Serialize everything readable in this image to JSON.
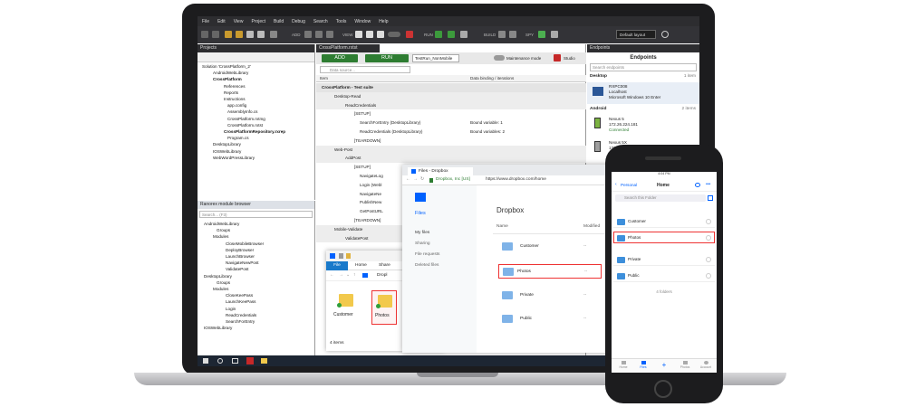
{
  "ide": {
    "menu": [
      "File",
      "Edit",
      "View",
      "Project",
      "Build",
      "Debug",
      "Search",
      "Tools",
      "Window",
      "Help"
    ],
    "toolbar": {
      "add": "ADD",
      "view": "VIEW",
      "run": "RUN",
      "build": "BUILD",
      "spy": "SPY",
      "layout": "Default layout"
    },
    "projects_title": "Projects",
    "projects_tree": [
      "Solution 'CrossPlatform_2'",
      "AndroidWebLibrary",
      "CrossPlatform",
      "References",
      "Reports",
      "Instructions",
      "app.config",
      "AssemblyInfo.cs",
      "CrossPlatform.rxtmg",
      "CrossPlatform.rxtst",
      "CrossPlatformRepository.rxrep",
      "Program.cs",
      "DesktopLibrary",
      "IOSWebLibrary",
      "WebWordPressLibrary"
    ],
    "modules_title": "Ranorex module browser",
    "search_placeholder": "Search... (F3)",
    "modules_tree": [
      "AndroidWebLibrary",
      "Groups",
      "Modules",
      "CloseMobileBrowser",
      "DeployBrowser",
      "LaunchBrowser",
      "NavigateNewPost",
      "ValidatePost",
      "DesktopLibrary",
      "Groups",
      "Modules",
      "CloseKeePass",
      "LaunchKeePass",
      "Login",
      "ReadCredentials",
      "SearchForEntry",
      "IOSWebLibrary"
    ],
    "editor_tab": "CrossPlatform.rxtst",
    "add_btn": "ADD",
    "run_btn": "RUN",
    "run_config": "TestRun_NonMobile",
    "maintenance": "Maintenance mode",
    "studio": "Studio",
    "data_source": "Data source...",
    "col_item": "Item",
    "col_binding": "Data binding / iterations",
    "suite_rows": [
      {
        "label": "CrossPlatform - Test suite",
        "b": ""
      },
      {
        "label": "Desktop-Read",
        "b": ""
      },
      {
        "label": "ReadCredentials",
        "b": ""
      },
      {
        "label": "[SETUP]",
        "b": ""
      },
      {
        "label": "SearchForEntry (DesktopLibrary)",
        "b": "Bound variable: 1"
      },
      {
        "label": "ReadCredentials (DesktopLibrary)",
        "b": "Bound variables: 2"
      },
      {
        "label": "[TEARDOWN]",
        "b": ""
      },
      {
        "label": "Web-Post",
        "b": ""
      },
      {
        "label": "AddPost",
        "b": ""
      },
      {
        "label": "[SETUP]",
        "b": ""
      },
      {
        "label": "NavigateLog",
        "b": ""
      },
      {
        "label": "Login (Webl",
        "b": ""
      },
      {
        "label": "NavigateNe",
        "b": ""
      },
      {
        "label": "PublishNew",
        "b": ""
      },
      {
        "label": "GetPostURL",
        "b": ""
      },
      {
        "label": "[TEARDOWN]",
        "b": ""
      },
      {
        "label": "Mobile-Validate",
        "b": ""
      },
      {
        "label": "ValidatePost",
        "b": ""
      }
    ],
    "endpoints_title": "Endpoints",
    "endpoints_header": "Endpoints",
    "search_endpoints": "Search endpoints",
    "desktop_label": "Desktop",
    "desktop_count": "1 item",
    "desktop_ep": {
      "name": "RXPC008",
      "host": "Localhost",
      "os": "Microsoft Windows 10 Enter"
    },
    "android_label": "Android",
    "android_count": "2 items",
    "android_ep1": {
      "name": "Nexus 5",
      "ip": "172.26.224.181",
      "status": "Connected"
    },
    "android_ep2": {
      "name": "Nexus 5X",
      "ip": "172.26.224.161"
    }
  },
  "browser": {
    "tab": "Files - Dropbox",
    "url_secure": "Dropbox, Inc [US]",
    "url": "https://www.dropbox.com/home",
    "nav": [
      "Files",
      "My files",
      "Sharing",
      "File requests",
      "Deleted files"
    ],
    "heading": "Dropbox",
    "col_name": "Name",
    "col_modified": "Modified",
    "files": [
      "Customer",
      "Photos",
      "Private",
      "Public"
    ],
    "dash": "--"
  },
  "explorer": {
    "tabs": [
      "File",
      "Home",
      "Share"
    ],
    "path": "Dropl",
    "folders": [
      "Customer",
      "Photos"
    ],
    "count": "4 items"
  },
  "phone": {
    "time": "4:04 PM",
    "back": "Personal",
    "title": "Home",
    "search": "Search this Folder",
    "folders": [
      "Customer",
      "Photos",
      "Private",
      "Public"
    ],
    "count": "4 folders",
    "tabs": [
      "Home",
      "Files",
      "",
      "Photos",
      "Account"
    ]
  }
}
